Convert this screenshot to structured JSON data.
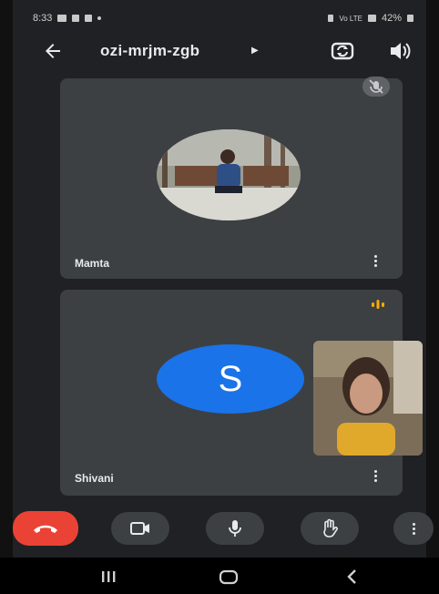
{
  "status_bar": {
    "time": "8:33",
    "battery": "42%",
    "network": "Vo LTE"
  },
  "header": {
    "meeting_code": "ozi-mrjm-zgb"
  },
  "participants": [
    {
      "name": "Mamta",
      "status": "muted"
    },
    {
      "name": "Shivani",
      "initial": "S",
      "status": "speaking"
    }
  ],
  "controls": {
    "end_call": "end-call",
    "camera": "camera",
    "microphone": "microphone",
    "raise_hand": "raise-hand",
    "more": "more-options"
  },
  "colors": {
    "background": "#202124",
    "tile": "#3c4043",
    "end_call": "#ea4335",
    "avatar": "#1a73e8",
    "speaking": "#f9ab00"
  }
}
